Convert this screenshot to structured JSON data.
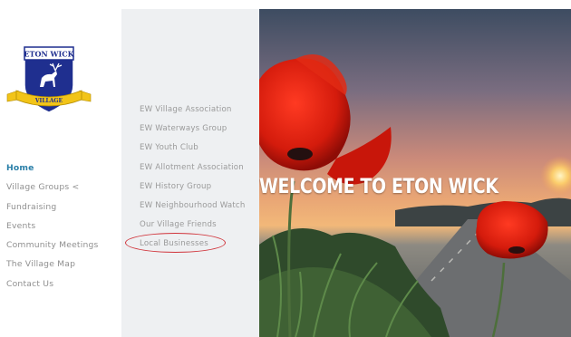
{
  "logo": {
    "top_text": "ETON WICK",
    "ribbon_text": "VILLAGE"
  },
  "nav": {
    "items": [
      {
        "label": "Home",
        "active": true
      },
      {
        "label": "Village Groups <"
      },
      {
        "label": "Fundraising"
      },
      {
        "label": "Events"
      },
      {
        "label": "Community Meetings"
      },
      {
        "label": "The Village Map"
      },
      {
        "label": "Contact Us"
      }
    ]
  },
  "submenu": {
    "items": [
      {
        "label": "EW Village Association"
      },
      {
        "label": "EW Waterways Group"
      },
      {
        "label": "EW Youth Club"
      },
      {
        "label": "EW Allotment Association"
      },
      {
        "label": "EW History Group"
      },
      {
        "label": "EW Neighbourhood Watch"
      },
      {
        "label": "Our Village Friends"
      },
      {
        "label": "Local Businesses",
        "highlighted": true
      }
    ]
  },
  "hero": {
    "title": "WELCOME TO ETON WICK"
  },
  "colors": {
    "active_nav": "#2a7fa8",
    "nav_text": "#8f8f8f",
    "submenu_bg": "#eef0f2",
    "highlight_ring": "#d0333a",
    "crest_blue": "#1f2f8f",
    "ribbon_gold": "#f2c418"
  }
}
